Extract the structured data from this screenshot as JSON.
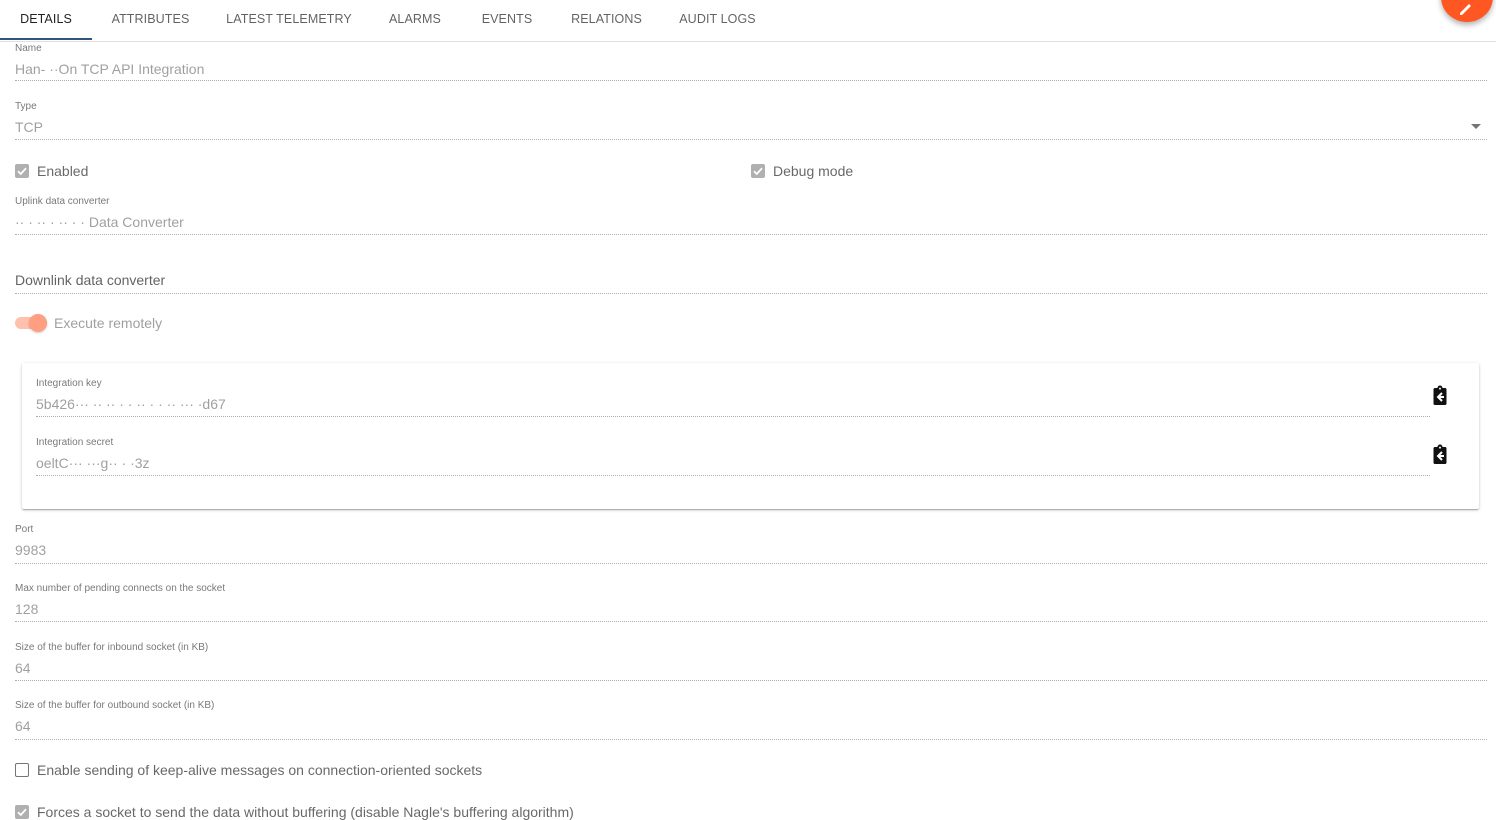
{
  "tabs": [
    {
      "label": "DETAILS"
    },
    {
      "label": "ATTRIBUTES"
    },
    {
      "label": "LATEST TELEMETRY"
    },
    {
      "label": "ALARMS"
    },
    {
      "label": "EVENTS"
    },
    {
      "label": "RELATIONS"
    },
    {
      "label": "AUDIT LOGS"
    }
  ],
  "fields": {
    "name": {
      "label": "Name",
      "value": "Han- ··On TCP API Integration"
    },
    "type": {
      "label": "Type",
      "value": "TCP"
    },
    "uplink": {
      "label": "Uplink data converter",
      "value": "·· ·  ··  ·  ··  · · Data Converter"
    },
    "downlink": {
      "label": "Downlink data converter"
    },
    "port": {
      "label": "Port",
      "value": "9983"
    },
    "max_pending": {
      "label": "Max number of pending connects on the socket",
      "value": "128"
    },
    "inbound_buffer": {
      "label": "Size of the buffer for inbound socket (in KB)",
      "value": "64"
    },
    "outbound_buffer": {
      "label": "Size of the buffer for outbound socket (in KB)",
      "value": "64"
    }
  },
  "checkboxes": {
    "enabled": {
      "label": "Enabled",
      "checked": true
    },
    "debug": {
      "label": "Debug mode",
      "checked": true
    },
    "keepalive": {
      "label": "Enable sending of keep-alive messages on connection-oriented sockets",
      "checked": false
    },
    "nodelay": {
      "label": "Forces a socket to send the data without buffering (disable Nagle's buffering algorithm)",
      "checked": true
    }
  },
  "execute_remotely": {
    "label": "Execute remotely",
    "on": true
  },
  "credentials": {
    "key": {
      "label": "Integration key",
      "value": "5b426··· ·· ·· · ·  ··  ·   ·  ··  ··· ·d67"
    },
    "secret": {
      "label": "Integration secret",
      "value": "oeltC··· ···g··  ·  ·3z"
    }
  },
  "colors": {
    "accent": "#305680",
    "fab": "#ff5722",
    "toggle": "#ff9e80"
  },
  "icons": {
    "fab": "edit-icon",
    "copy": "clipboard-copy-icon",
    "dropdown": "arrow-drop-down-icon"
  }
}
